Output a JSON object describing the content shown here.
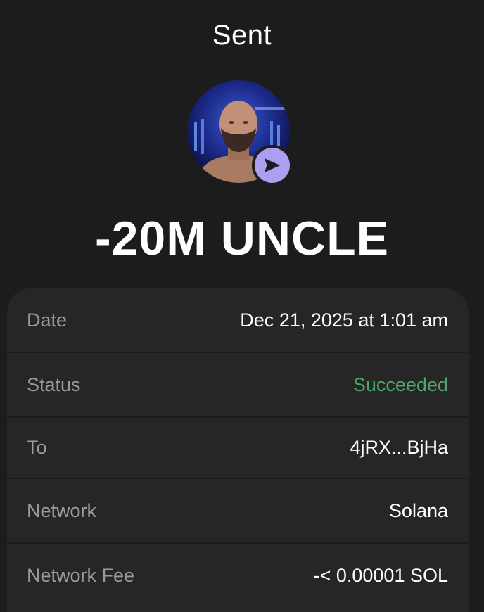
{
  "header": {
    "title": "Sent"
  },
  "token": {
    "avatar_icon": "token-avatar-icon",
    "badge_icon": "send-arrow-icon"
  },
  "amount": "-20M UNCLE",
  "details": [
    {
      "label": "Date",
      "value": "Dec 21, 2025 at 1:01 am",
      "status": "normal"
    },
    {
      "label": "Status",
      "value": "Succeeded",
      "status": "success"
    },
    {
      "label": "To",
      "value": "4jRX...BjHa",
      "status": "normal"
    },
    {
      "label": "Network",
      "value": "Solana",
      "status": "normal"
    },
    {
      "label": "Network Fee",
      "value": "-< 0.00001 SOL",
      "status": "normal"
    }
  ],
  "colors": {
    "background": "#1c1c1c",
    "card": "#262626",
    "success": "#4fa66a",
    "accent": "#ab9ff2",
    "label": "#9a9a9a"
  }
}
